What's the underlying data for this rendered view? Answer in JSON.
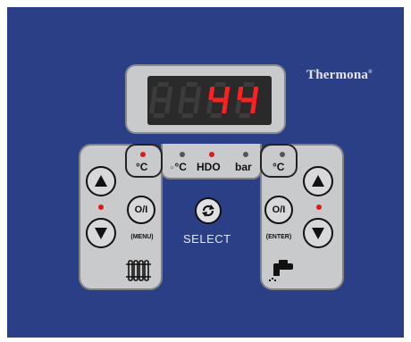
{
  "brand": {
    "name": "Thermona",
    "mark": "®"
  },
  "display": {
    "value": "44",
    "blank_digits": 2,
    "digit_color": "#ff2020",
    "unlit_color": "#3c3c3c"
  },
  "indicators": [
    {
      "id": "left-c",
      "label": "°C",
      "state": "on"
    },
    {
      "id": "outdoor-c",
      "label": "°C",
      "state": "off"
    },
    {
      "id": "hdo",
      "label": "HDO",
      "state": "on"
    },
    {
      "id": "bar",
      "label": "bar",
      "state": "off"
    },
    {
      "id": "right-c",
      "label": "°C",
      "state": "off"
    }
  ],
  "left_panel": {
    "power_label": "O/I",
    "menu_label": "(MENU)",
    "icon": "radiator-icon",
    "led_state": "on"
  },
  "right_panel": {
    "power_label": "O/I",
    "enter_label": "(ENTER)",
    "icon": "faucet-icon",
    "led_state": "on"
  },
  "select": {
    "label": "SELECT",
    "icon": "cycle-arrows-icon"
  },
  "colors": {
    "panel": "#2b3f86",
    "plate": "#c9cacc",
    "led_on": "#e01818",
    "led_off": "#555555"
  }
}
